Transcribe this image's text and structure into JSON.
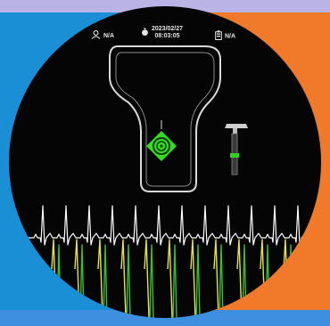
{
  "status_bar": {
    "user_value": "N/A",
    "date": "2023/02/27",
    "time": "08:03:05",
    "battery_value": "N/A"
  },
  "icons": [
    "user-icon",
    "timer-icon",
    "battery-icon",
    "target-icon",
    "instrument-icon"
  ],
  "colors": {
    "background_left": "#1b8fd6",
    "background_right": "#f07a2a",
    "screen": "#050505",
    "outline": "#d9d9d9",
    "target_green": "#33dd22",
    "trace_white": "#ffffff",
    "trace_yellow": "#e6e43a",
    "trace_green": "#37c037"
  }
}
